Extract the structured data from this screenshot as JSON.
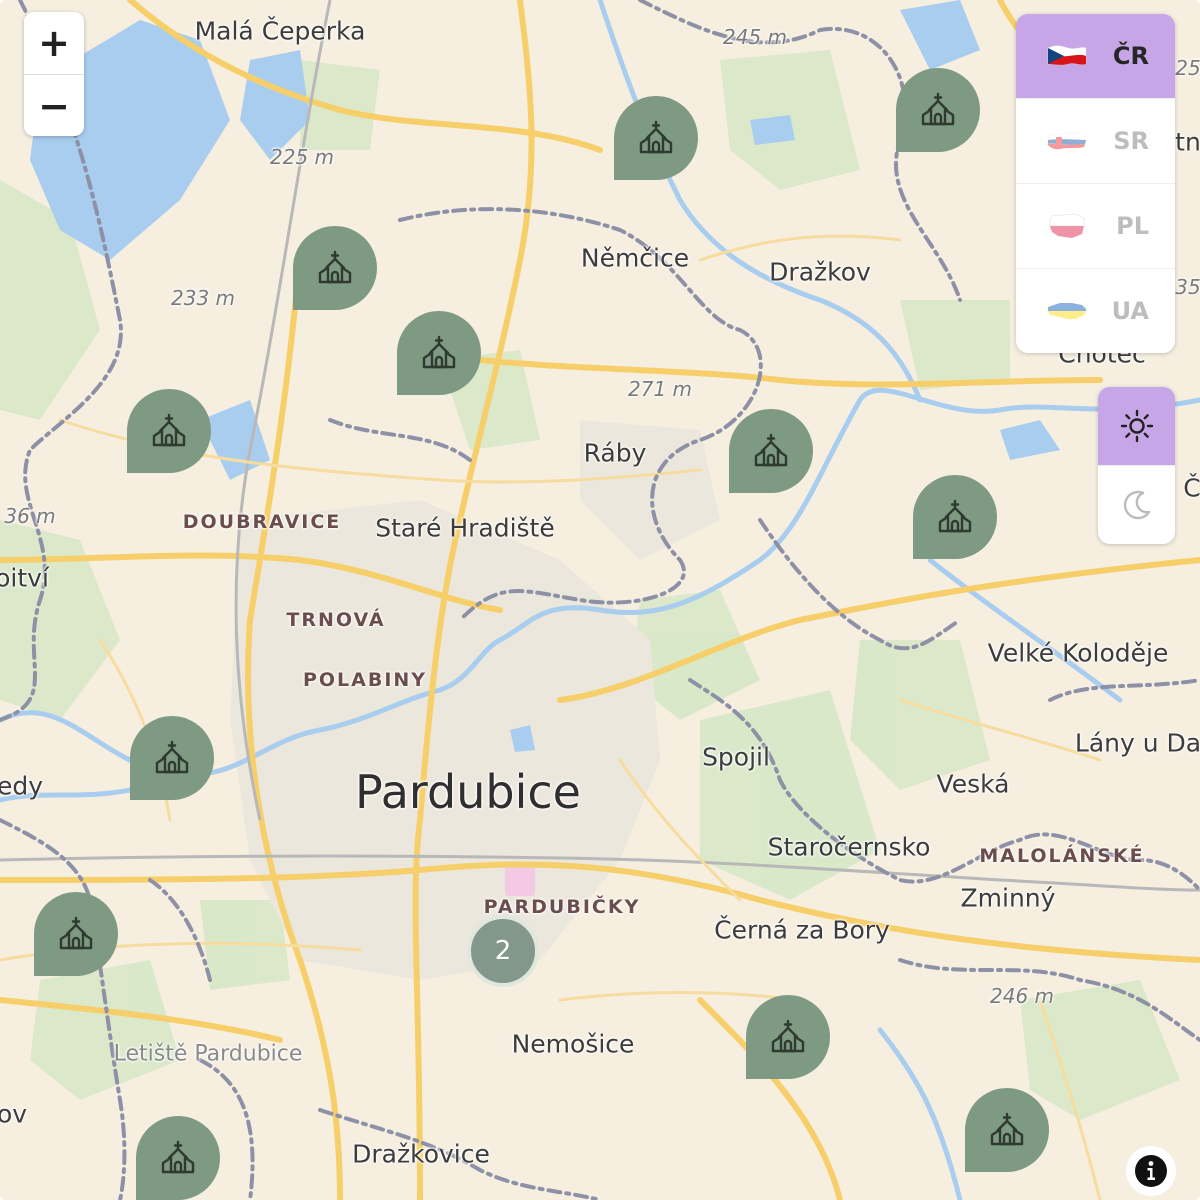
{
  "map": {
    "city": "Pardubice",
    "places": [
      {
        "id": "mala-ceperka",
        "text": "Malá Čeperka"
      },
      {
        "id": "nemcice",
        "text": "Němčice"
      },
      {
        "id": "drazkov",
        "text": "Dražkov"
      },
      {
        "id": "chotec",
        "text": "Choteč"
      },
      {
        "id": "raby",
        "text": "Ráby"
      },
      {
        "id": "stare-hradiste",
        "text": "Staré Hradiště"
      },
      {
        "id": "velke-kolodeje",
        "text": "Velké Koloděje"
      },
      {
        "id": "lany-u-da",
        "text": "Lány u Da"
      },
      {
        "id": "spojil",
        "text": "Spojil"
      },
      {
        "id": "veska",
        "text": "Veská"
      },
      {
        "id": "starocernsko",
        "text": "Staročernsko"
      },
      {
        "id": "zminny",
        "text": "Zminný"
      },
      {
        "id": "cerna-za-bory",
        "text": "Černá za Bory"
      },
      {
        "id": "nemosice",
        "text": "Nemošice"
      },
      {
        "id": "drazkovice",
        "text": "Dražkovice"
      },
      {
        "id": "edy",
        "text": "edy"
      },
      {
        "id": "oitvi",
        "text": "oitví"
      }
    ],
    "districts": [
      {
        "id": "doubravice",
        "text": "DOUBRAVICE"
      },
      {
        "id": "trnova",
        "text": "TRNOVÁ"
      },
      {
        "id": "polabiny",
        "text": "POLABINY"
      },
      {
        "id": "malolanske",
        "text": "MALOLÁNSKÉ"
      },
      {
        "id": "pardubicky",
        "text": "PARDUBIČKY"
      }
    ],
    "elevations": [
      {
        "id": "e245",
        "text": "245 m"
      },
      {
        "id": "e225",
        "text": "225 m"
      },
      {
        "id": "e233",
        "text": "233 m"
      },
      {
        "id": "e271",
        "text": "271 m"
      },
      {
        "id": "e36",
        "text": "36 m"
      },
      {
        "id": "e246",
        "text": "246 m"
      },
      {
        "id": "e25",
        "text": "25"
      },
      {
        "id": "e35",
        "text": "35"
      }
    ],
    "poi": [
      {
        "id": "letiste",
        "text": "Letiště Pardubice"
      }
    ],
    "edge_fragments": [
      {
        "id": "ov",
        "text": "ov"
      },
      {
        "id": "tn",
        "text": "tn"
      },
      {
        "id": "c",
        "text": "Č"
      }
    ],
    "marker_icon": "church-icon",
    "marker_color": "#7f9a82",
    "cluster": {
      "count": "2",
      "color": "#83988a"
    }
  },
  "controls": {
    "zoom_in_label": "+",
    "zoom_out_label": "−"
  },
  "languages": [
    {
      "code": "ČR",
      "flag": "czech-flag-icon",
      "active": true
    },
    {
      "code": "SR",
      "flag": "slovak-flag-icon",
      "active": false
    },
    {
      "code": "PL",
      "flag": "poland-flag-icon",
      "active": false
    },
    {
      "code": "UA",
      "flag": "ukraine-flag-icon",
      "active": false
    }
  ],
  "theme": {
    "options": [
      {
        "name": "light",
        "icon": "sun-icon",
        "active": true
      },
      {
        "name": "dark",
        "icon": "moon-icon",
        "active": false
      }
    ]
  },
  "colors": {
    "accent": "#c6a6e6",
    "land": "#f6efe0",
    "water": "#a9cdee",
    "forest": "#d8e8c8",
    "road": "#f7cf6a",
    "boundary": "#8e90a6"
  },
  "info_icon": "info-icon"
}
